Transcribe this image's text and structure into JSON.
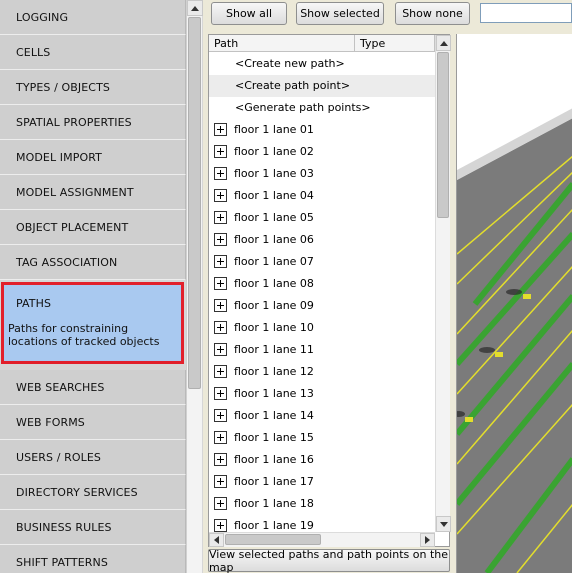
{
  "sidebar": {
    "items": [
      {
        "label": "LOGGING"
      },
      {
        "label": "CELLS"
      },
      {
        "label": "TYPES / OBJECTS"
      },
      {
        "label": "SPATIAL PROPERTIES"
      },
      {
        "label": "MODEL IMPORT"
      },
      {
        "label": "MODEL ASSIGNMENT"
      },
      {
        "label": "OBJECT PLACEMENT"
      },
      {
        "label": "TAG ASSOCIATION"
      },
      {
        "label": "PATHS",
        "description": "Paths for constraining locations of tracked objects"
      },
      {
        "label": "WEB SEARCHES"
      },
      {
        "label": "WEB FORMS"
      },
      {
        "label": "USERS / ROLES"
      },
      {
        "label": "DIRECTORY SERVICES"
      },
      {
        "label": "BUSINESS RULES"
      },
      {
        "label": "SHIFT PATTERNS"
      }
    ],
    "active_index": 8
  },
  "toolbar": {
    "show_all": "Show all",
    "show_selected": "Show selected",
    "show_none": "Show none",
    "filter_value": ""
  },
  "list": {
    "columns": [
      "Path",
      "Type"
    ],
    "commands": [
      "<Create new path>",
      "<Create path point>",
      "<Generate path points>"
    ],
    "paths": [
      "floor 1 lane 01",
      "floor 1 lane 02",
      "floor 1 lane 03",
      "floor 1 lane 04",
      "floor 1 lane 05",
      "floor 1 lane 06",
      "floor 1 lane 07",
      "floor 1 lane 08",
      "floor 1 lane 09",
      "floor 1 lane 10",
      "floor 1 lane 11",
      "floor 1 lane 12",
      "floor 1 lane 13",
      "floor 1 lane 14",
      "floor 1 lane 15",
      "floor 1 lane 16",
      "floor 1 lane 17",
      "floor 1 lane 18",
      "floor 1 lane 19"
    ]
  },
  "map_button": "View selected paths and path points on the map",
  "colors": {
    "active_item_bg": "#a9c9f0",
    "active_item_border": "#e2202b",
    "floor_gray": "#7b7b7b",
    "lane_green": "#3aa332",
    "lane_yellow": "#e3de2c"
  },
  "icons": {
    "expander": "plus-box-icon",
    "scroll_up": "arrow-up-icon",
    "scroll_down": "arrow-down-icon",
    "scroll_left": "arrow-left-icon",
    "scroll_right": "arrow-right-icon"
  }
}
